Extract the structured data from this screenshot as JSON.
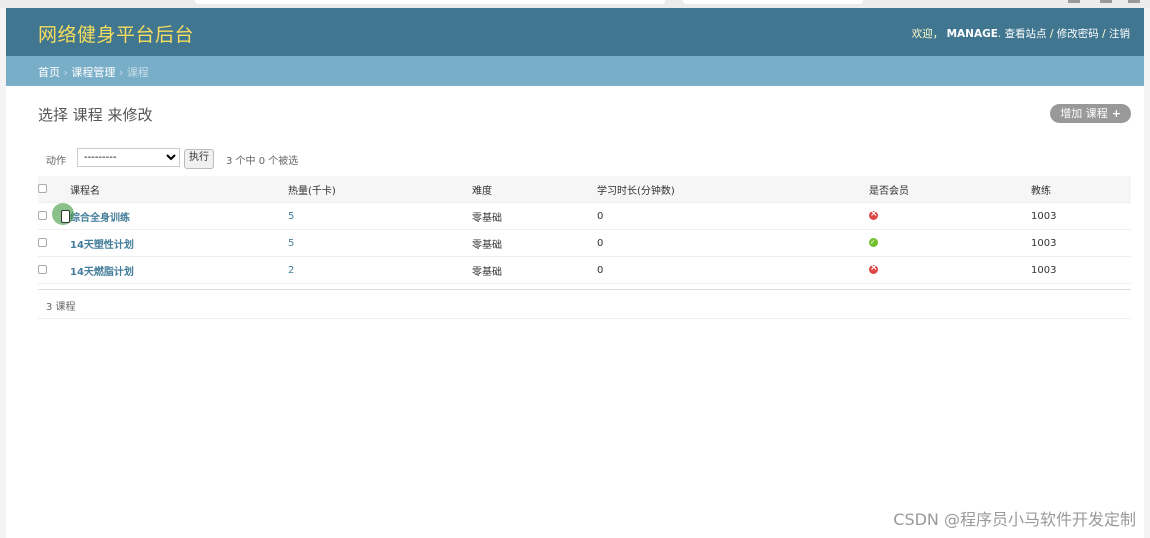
{
  "header": {
    "brand": "网络健身平台后台",
    "welcome": "欢迎，",
    "username": "MANAGE",
    "sep1": ".",
    "view_site": "查看站点",
    "slash1": " / ",
    "change_password": "修改密码",
    "slash2": " / ",
    "logout": "注销"
  },
  "breadcrumbs": {
    "home": "首页",
    "sep": " › ",
    "app": "课程管理",
    "current": "课程"
  },
  "page": {
    "title": "选择 课程 来修改",
    "add_label": "增加 课程"
  },
  "actions": {
    "label": "动作",
    "selected": "---------",
    "go_label": "执行",
    "counter": "3 个中 0 个被选"
  },
  "table": {
    "headers": [
      "课程名",
      "热量(千卡)",
      "难度",
      "学习时长(分钟数)",
      "是否会员",
      "教练"
    ],
    "rows": [
      {
        "name": "综合全身训练",
        "calories": "5",
        "difficulty": "零基础",
        "duration": "0",
        "member": false,
        "coach": "1003"
      },
      {
        "name": "14天塑性计划",
        "calories": "5",
        "difficulty": "零基础",
        "duration": "0",
        "member": true,
        "coach": "1003"
      },
      {
        "name": "14天燃脂计划",
        "calories": "2",
        "difficulty": "零基础",
        "duration": "0",
        "member": false,
        "coach": "1003"
      }
    ]
  },
  "paginator": "3 课程",
  "watermark": "CSDN @程序员小马软件开发定制",
  "colors": {
    "header": "#417690",
    "breadcrumbs": "#79aec8",
    "brand": "#f5dd5d",
    "link": "#447e9b",
    "no": "#dd4646",
    "yes": "#70bf2b"
  }
}
